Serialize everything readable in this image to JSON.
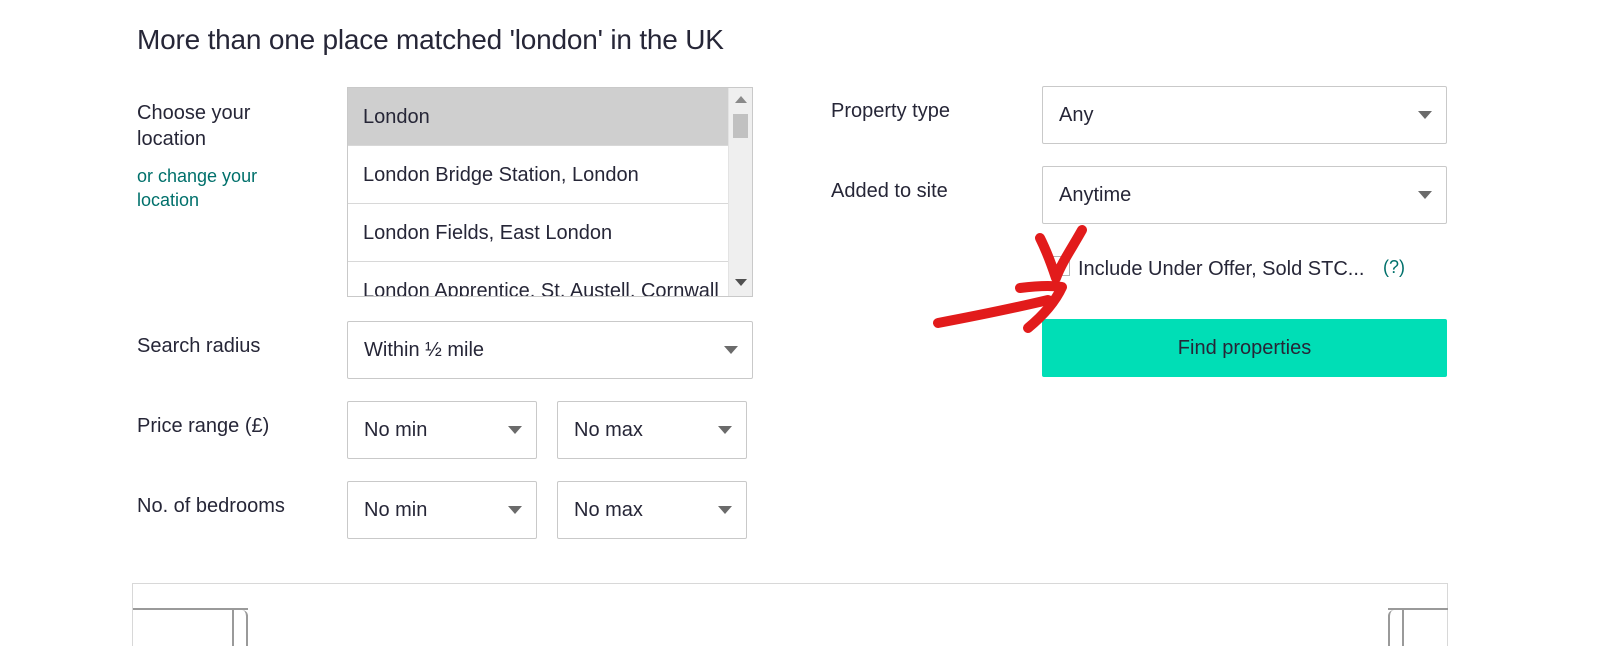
{
  "page": {
    "title": "More than one place matched 'london' in the UK"
  },
  "location": {
    "label": "Choose your location",
    "change_link": "or change your location",
    "options": [
      "London",
      "London Bridge Station, London",
      "London Fields, East London",
      "London Apprentice, St. Austell, Cornwall"
    ],
    "selected": "London"
  },
  "search_radius": {
    "label": "Search radius",
    "value": "Within ½ mile"
  },
  "price_range": {
    "label": "Price range (£)",
    "min": "No min",
    "max": "No max"
  },
  "bedrooms": {
    "label": "No. of bedrooms",
    "min": "No min",
    "max": "No max"
  },
  "property_type": {
    "label": "Property type",
    "value": "Any"
  },
  "added_to_site": {
    "label": "Added to site",
    "value": "Anytime"
  },
  "include_under_offer": {
    "label": "Include Under Offer, Sold STC...",
    "help": "(?)",
    "checked": false
  },
  "actions": {
    "find_label": "Find properties"
  },
  "colors": {
    "accent": "#00deb6",
    "link": "#00706b",
    "annotation": "#e21b1b"
  },
  "icons": {
    "select_caret": "caret-down-icon",
    "scroll_up": "scroll-up-arrow-icon",
    "scroll_down": "scroll-down-arrow-icon"
  }
}
